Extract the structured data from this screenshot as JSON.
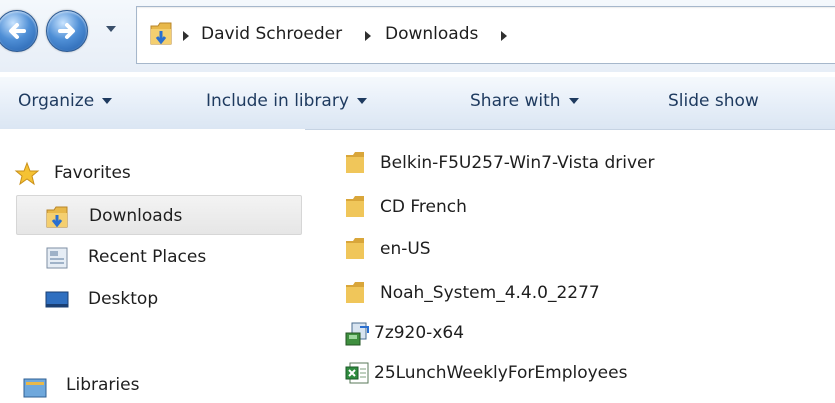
{
  "breadcrumb": [
    "David Schroeder",
    "Downloads"
  ],
  "toolbar": {
    "organize": "Organize",
    "include_in_library": "Include in library",
    "share_with": "Share with",
    "slide_show": "Slide show"
  },
  "sidebar": {
    "favorites": "Favorites",
    "items": [
      {
        "label": "Downloads",
        "icon": "downloads-folder-icon",
        "selected": true
      },
      {
        "label": "Recent Places",
        "icon": "recent-places-icon"
      },
      {
        "label": "Desktop",
        "icon": "desktop-icon"
      }
    ],
    "libraries": "Libraries"
  },
  "files": [
    {
      "name": "Belkin-F5U257-Win7-Vista driver",
      "icon": "folder-icon"
    },
    {
      "name": "CD French",
      "icon": "folder-icon"
    },
    {
      "name": "en-US",
      "icon": "folder-icon"
    },
    {
      "name": "Noah_System_4.4.0_2277",
      "icon": "folder-icon"
    },
    {
      "name": "7z920-x64",
      "icon": "installer-icon"
    },
    {
      "name": "25LunchWeeklyForEmployees",
      "icon": "spreadsheet-icon"
    }
  ],
  "colors": {
    "command_text": "#1e3a5f",
    "folder_yellow": "#e8b84a",
    "nav_blue": "#1e5aa8"
  }
}
